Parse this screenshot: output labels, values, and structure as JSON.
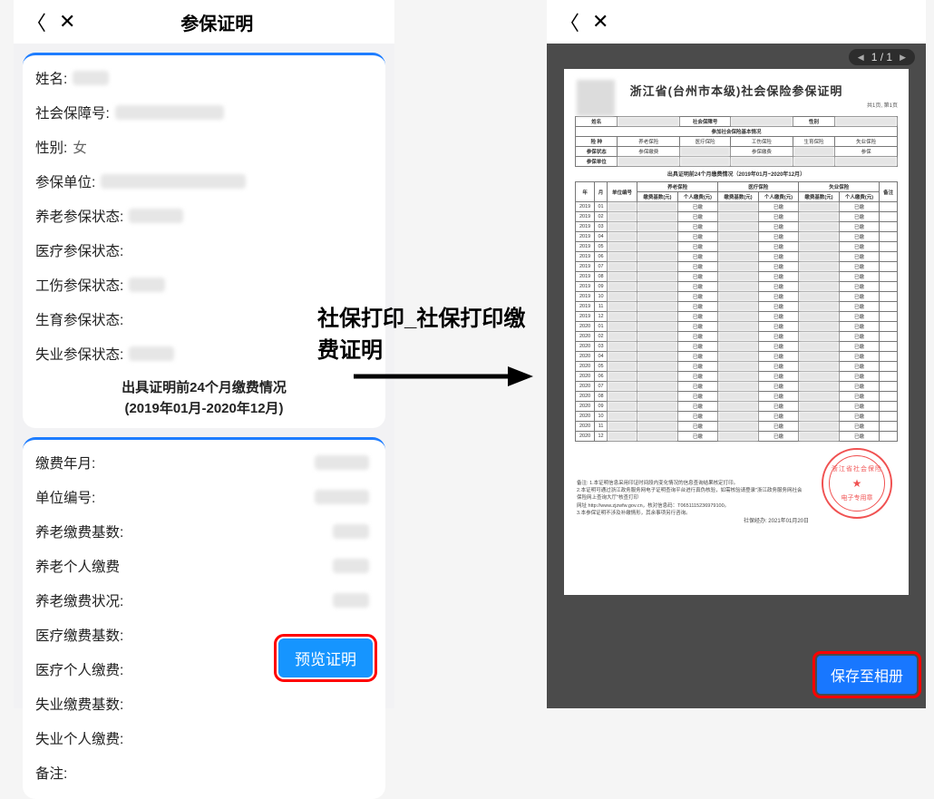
{
  "annotation": {
    "line1": "社保打印_社保打印缴",
    "line2": "费证明"
  },
  "left": {
    "header_title": "参保证明",
    "rows1": [
      {
        "label": "姓名:",
        "blur_w": 40
      },
      {
        "label": "社会保障号:",
        "blur_w": 120
      },
      {
        "label": "性别:",
        "value": "女"
      },
      {
        "label": "参保单位:",
        "blur_w": 160
      },
      {
        "label": "养老参保状态:",
        "blur_w": 60
      },
      {
        "label": "医疗参保状态:",
        "blur_w": 0
      },
      {
        "label": "工伤参保状态:",
        "blur_w": 40
      },
      {
        "label": "生育参保状态:",
        "blur_w": 0
      },
      {
        "label": "失业参保状态:",
        "blur_w": 50
      }
    ],
    "footer_line1": "出具证明前24个月缴费情况",
    "footer_line2": "(2019年01月-2020年12月)",
    "rows2": [
      {
        "label": "缴费年月:",
        "blur_w": 60
      },
      {
        "label": "单位编号:",
        "blur_w": 60
      },
      {
        "label": "养老缴费基数:",
        "blur_w": 40
      },
      {
        "label": "养老个人缴费",
        "blur_w": 40
      },
      {
        "label": "养老缴费状况:",
        "blur_w": 40
      },
      {
        "label": "医疗缴费基数:",
        "blur_w": 0
      },
      {
        "label": "医疗个人缴费:",
        "blur_w": 0
      },
      {
        "label": "失业缴费基数:",
        "blur_w": 0
      },
      {
        "label": "失业个人缴费:",
        "blur_w": 0
      },
      {
        "label": "备注:",
        "blur_w": 0
      }
    ],
    "preview_button": "预览证明"
  },
  "right": {
    "page_indicator": "1 / 1",
    "doc_title": "浙江省(台州市本级)社会保险参保证明",
    "doc_subright": "共1页, 第1页",
    "info_headers": [
      "姓名",
      "",
      "社会保障号",
      "",
      "性别",
      ""
    ],
    "info_section_title": "参加社会保险基本情况",
    "info_row2": [
      "险  种",
      "养老保险",
      "医疗保险",
      "工伤保险",
      "生育保险",
      "失业保险"
    ],
    "info_row3": [
      "参保状态",
      "参保缴费",
      "",
      "参保缴费",
      "",
      "参保"
    ],
    "info_row4": [
      "参保单位",
      "",
      "",
      "",
      "",
      ""
    ],
    "history_title": "出具证明前24个月缴费情况（2019年01月~2020年12月）",
    "table_head_top": [
      "年",
      "月",
      "单位编号",
      "养老保险",
      "医疗保险",
      "失业保险",
      "备注"
    ],
    "table_head_sub": [
      "缴费基数(元)",
      "个人缴费(元)",
      "缴费基数(元)",
      "个人缴费(元)",
      "缴费基数(元)",
      "个人缴费(元)"
    ],
    "months": [
      [
        "2019",
        "01"
      ],
      [
        "2019",
        "02"
      ],
      [
        "2019",
        "03"
      ],
      [
        "2019",
        "04"
      ],
      [
        "2019",
        "05"
      ],
      [
        "2019",
        "06"
      ],
      [
        "2019",
        "07"
      ],
      [
        "2019",
        "08"
      ],
      [
        "2019",
        "09"
      ],
      [
        "2019",
        "10"
      ],
      [
        "2019",
        "11"
      ],
      [
        "2019",
        "12"
      ],
      [
        "2020",
        "01"
      ],
      [
        "2020",
        "02"
      ],
      [
        "2020",
        "03"
      ],
      [
        "2020",
        "04"
      ],
      [
        "2020",
        "05"
      ],
      [
        "2020",
        "06"
      ],
      [
        "2020",
        "07"
      ],
      [
        "2020",
        "08"
      ],
      [
        "2020",
        "09"
      ],
      [
        "2020",
        "10"
      ],
      [
        "2020",
        "11"
      ],
      [
        "2020",
        "12"
      ]
    ],
    "status_cell": "已缴",
    "notes_label": "备注:",
    "notes_1": "1.本证明信息采用印证时间段内变化情况的信息查询结果核定打印。",
    "notes_2": "2.本证明可通过浙江政务服务网电子证明查询平台进行真伪核验，如需核验请登录\"浙江政务服务网社会保险网上查询大厅\"核查打印",
    "notes_3": "网址 http://www.zjzwfw.gov.cn，核对信息码：T0651115236979100。",
    "notes_4": "3.本参保证明不涉及补缴情形，其余事项另行咨询。",
    "date_label": "社保经办:  2021年01月20日",
    "stamp_outer": "浙江省社会保险",
    "stamp_inner": "电子专用章",
    "save_button": "保存至相册"
  }
}
